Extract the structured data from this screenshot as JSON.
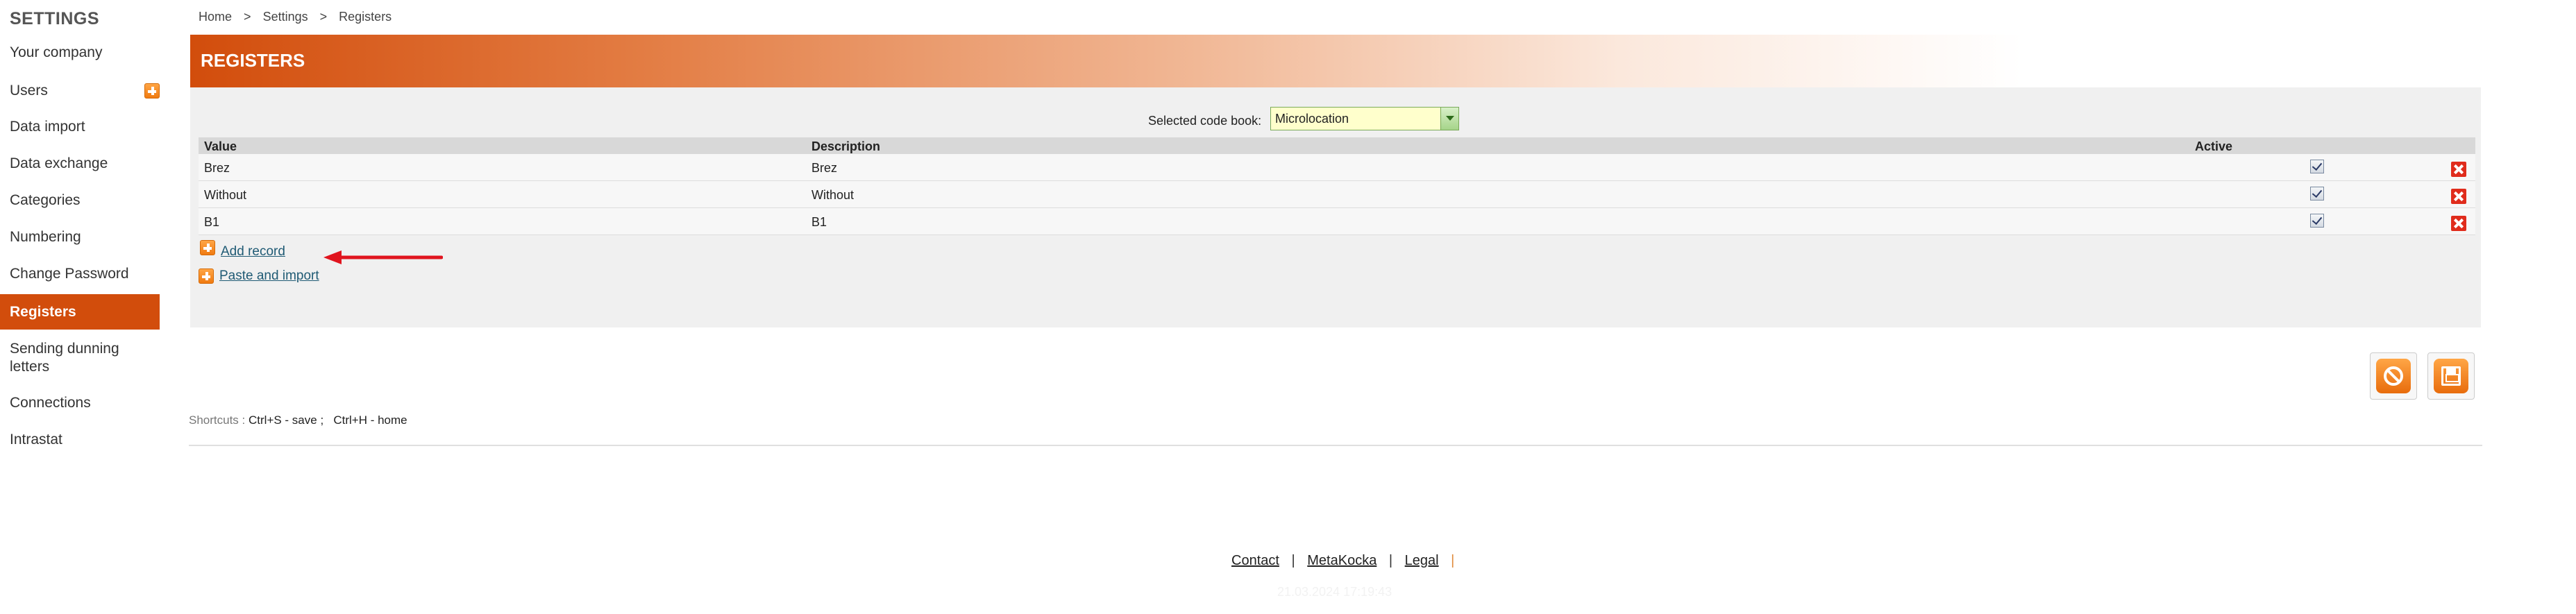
{
  "sidebar": {
    "title": "SETTINGS",
    "items": [
      {
        "label": "Your company"
      },
      {
        "label": "Users"
      },
      {
        "label": "Data import"
      },
      {
        "label": "Data exchange"
      },
      {
        "label": "Categories"
      },
      {
        "label": "Numbering"
      },
      {
        "label": "Change Password"
      },
      {
        "label": "Registers"
      },
      {
        "label": "Sending dunning letters"
      },
      {
        "label": "Connections"
      },
      {
        "label": "Intrastat"
      }
    ],
    "active_item": "Registers"
  },
  "breadcrumb": {
    "items": [
      "Home",
      "Settings",
      "Registers"
    ],
    "separator": ">"
  },
  "page_title": "REGISTERS",
  "codebook": {
    "label": "Selected code book:",
    "selected": "Microlocation"
  },
  "table": {
    "headers": {
      "value": "Value",
      "description": "Description",
      "active": "Active"
    },
    "rows": [
      {
        "value": "Brez",
        "description": "Brez",
        "active": true
      },
      {
        "value": "Without",
        "description": "Without",
        "active": true
      },
      {
        "value": "B1",
        "description": "B1",
        "active": true
      }
    ]
  },
  "actions": {
    "add_record": "Add record",
    "paste_import": "Paste and import"
  },
  "shortcuts": {
    "label": "Shortcuts :",
    "save": "Ctrl+S - save ;",
    "home": "Ctrl+H - home"
  },
  "footer": {
    "links": [
      "Contact",
      "MetaKocka",
      "Legal"
    ],
    "separator": "|",
    "timestamp": "21.03.2024 17:19:43"
  },
  "colors": {
    "accent": "#d24d0c",
    "button_orange": "#f07a10",
    "delete_red": "#e02c1c",
    "annotation_arrow": "#e0141e"
  },
  "icons": [
    "plus-icon",
    "checkbox-icon",
    "delete-icon",
    "cancel-icon",
    "save-icon",
    "dropdown-arrow-icon"
  ]
}
